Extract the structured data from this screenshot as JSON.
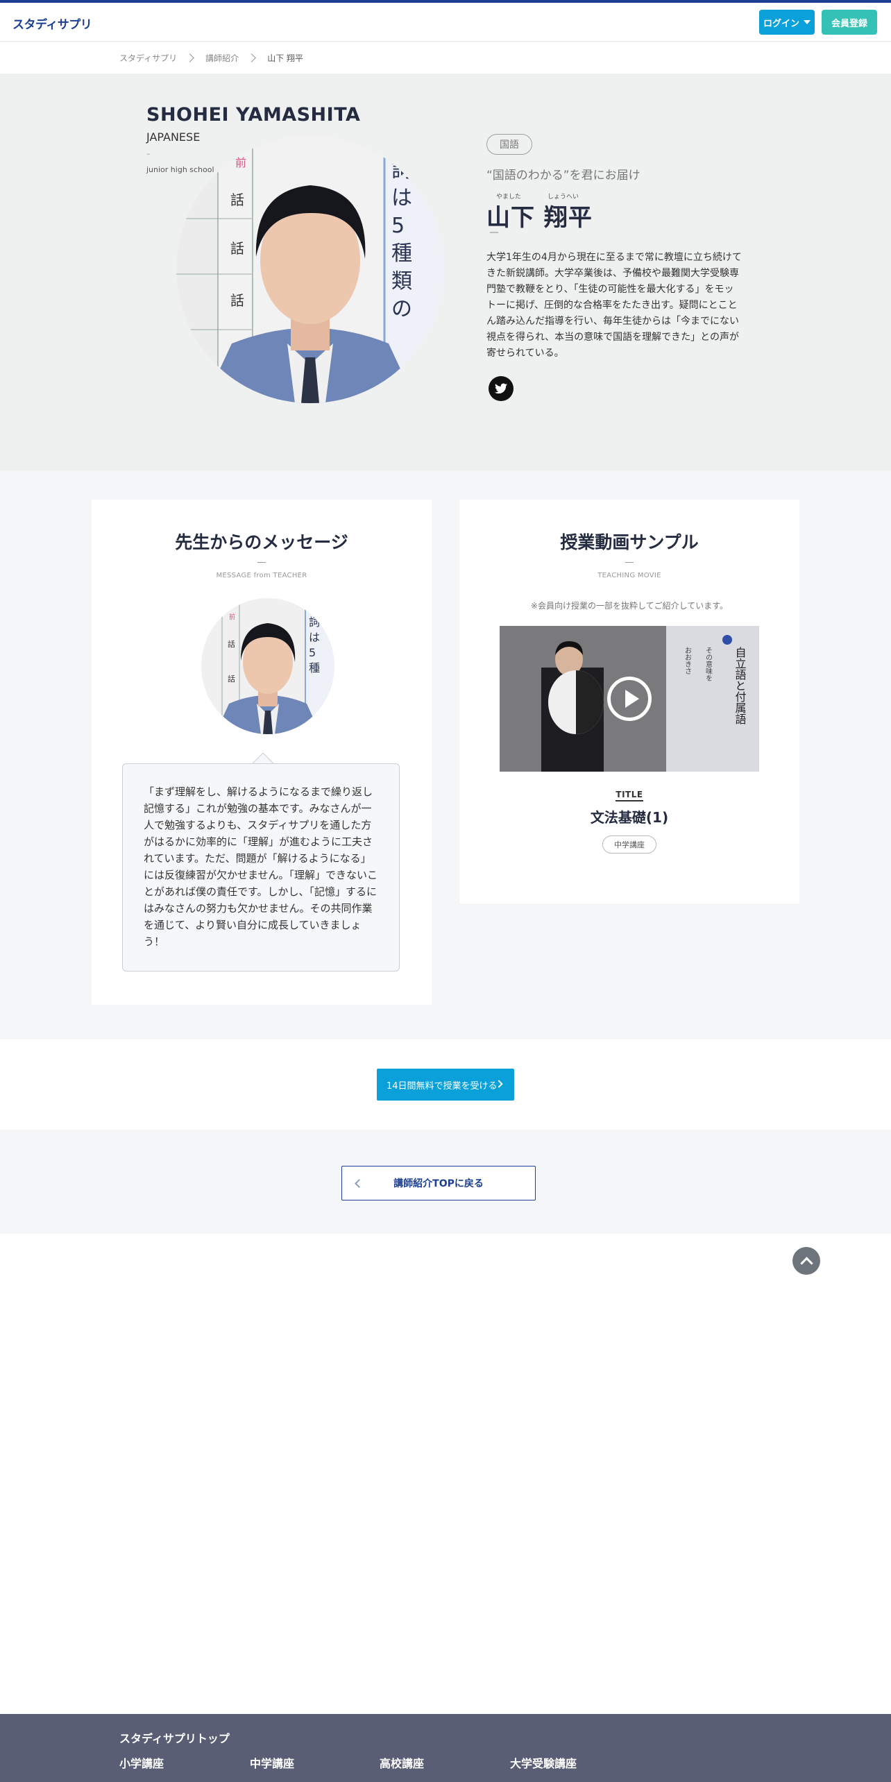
{
  "header": {
    "logo": "スタディサプリ",
    "login_label": "ログイン",
    "register_label": "会員登録"
  },
  "breadcrumb": [
    "スタディサプリ",
    "講師紹介",
    "山下 翔平"
  ],
  "teacher": {
    "name_en": "SHOHEI YAMASHITA",
    "subject_en": "JAPANESE",
    "dash": "–",
    "level_en": "junior high school",
    "subject_badge": "国語",
    "catchphrase": "“国語のわかる”を君にお届け",
    "ruby_family": "やました",
    "ruby_given": "しょうへい",
    "name_jp": "山下 翔平",
    "bio": "大学1年生の4月から現在に至るまで常に教壇に立ち続けてきた新鋭講師。大学卒業後は、予備校や最難関大学受験専門塾で教鞭をとり、「生徒の可能性を最大化する」をモットーに掲げ、圧倒的な合格率をたたき出す。疑問にとことん踏み込んだ指導を行い、毎年生徒からは「今までにない視点を得られ、本当の意味で国語を理解できた」との声が寄せられている。"
  },
  "message": {
    "title": "先生からのメッセージ",
    "subtitle": "MESSAGE from TEACHER",
    "body": "「まず理解をし、解けるようになるまで繰り返し記憶する」これが勉強の基本です。みなさんが一人で勉強するよりも、スタディサプリを通した方がはるかに効率的に「理解」が進むように工夫されています。ただ、問題が「解けるようになる」には反復練習が欠かせません。「理解」できないことがあれば僕の責任です。しかし、「記憶」するにはみなさんの努力も欠かせません。その共同作業を通じて、より賢い自分に成長していきましょう！"
  },
  "movie": {
    "title": "授業動画サンプル",
    "subtitle": "TEACHING MOVIE",
    "note": "※会員向け授業の一部を抜粋してご紹介しています。",
    "label": "TITLE",
    "name": "文法基礎(1)",
    "badge": "中学講座"
  },
  "cta_label": "14日間無料で授業を受ける",
  "back_label": "講師紹介TOPに戻る",
  "footer": {
    "top": "スタディサプリトップ",
    "links": [
      "小学講座",
      "中学講座",
      "高校講座",
      "大学受験講座"
    ]
  },
  "colors": {
    "brand": "#1c3f94",
    "accent": "#0aa0d9",
    "register": "#35c1b5",
    "footer": "#595e74"
  },
  "icons": [
    "twitter-icon",
    "play-icon",
    "chevron-right-icon",
    "chevron-left-icon",
    "chevron-up-icon",
    "caret-down-icon"
  ]
}
